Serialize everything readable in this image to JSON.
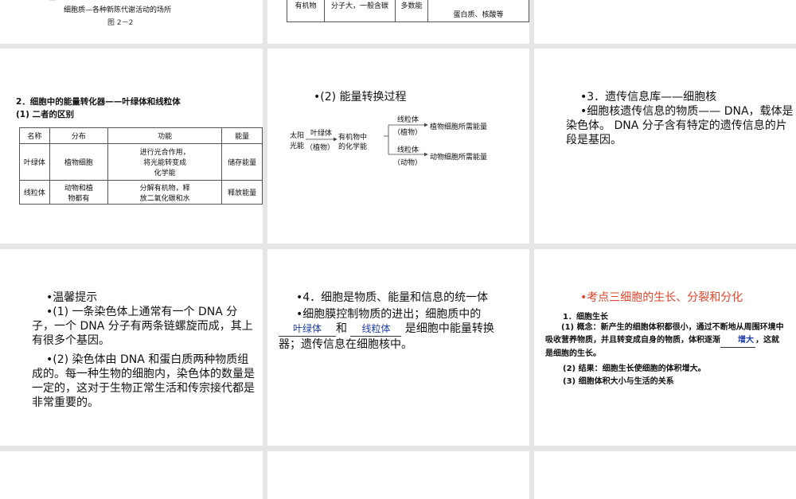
{
  "s_cell_top": {
    "caption": "细胞质—各种新陈代谢活动的场所",
    "figure": "图 2－2"
  },
  "s_org_top": {
    "row_name": "有机物",
    "col1": "分子大，一般含碳",
    "col2": "多数能",
    "col3": "蛋白质、核酸等"
  },
  "s_convert": {
    "heading": "2．细胞中的能量转化器——叶绿体和线粒体",
    "subheading": "(1)  二者的区别",
    "headers": [
      "名称",
      "分布",
      "功能",
      "能量"
    ],
    "rows": [
      {
        "name": "叶绿体",
        "dist": "植物细胞",
        "func": [
          "进行光合作用，",
          "将光能转变成",
          "化学能"
        ],
        "energy": "储存能量"
      },
      {
        "name": "线粒体",
        "dist": [
          "动物和植",
          "物都有"
        ],
        "func": [
          "分解有机物，释",
          "放二氧化碳和水"
        ],
        "energy": "释放能量"
      }
    ]
  },
  "s_process": {
    "title": "•(2) 能量转换过程",
    "src1": "太阳",
    "src2": "光能",
    "lbl1": "叶绿体",
    "lbl2": "（植物）",
    "mid1": "有机物中",
    "mid2": "的化学能",
    "top1": "线粒体",
    "top2": "（植物）",
    "top_target": "植物细胞所需能量",
    "bot1": "线粒体",
    "bot2": "（动物）",
    "bot_target": "动物细胞所需能量"
  },
  "s_nucleus": {
    "title": "•3．遗传信息库——细胞核",
    "body": "•细胞核遗传信息的物质—— DNA，载体是染色体。 DNA 分子含有特定的遗传信息的片段是基因。"
  },
  "s_tips": {
    "title": "•温馨提示",
    "p1": "•(1) 一条染色体上通常有一个 DNA 分子，一个 DNA 分子有两条链螺旋而成，其上有很多个基因。",
    "p2": "•(2) 染色体由 DNA 和蛋白质两种物质组成的。每一种生物的细胞内，染色体的数量是一定的，这对于生物正常生活和传宗接代都是非常重要的。"
  },
  "s_unity": {
    "title": "•4．细胞是物质、能量和信息的统一体",
    "p1": "•细胞膜控制物质的进出；细胞质中的",
    "blank1": "叶绿体",
    "and": "和",
    "blank2": "线粒体",
    "p2": "是细胞中能量转换",
    "p3": "器；遗传信息在细胞核中。"
  },
  "s_growth": {
    "title": "•考点三细胞的生长、分裂和分化",
    "h1": "1．细胞生长",
    "p1": "(1) 概念：新产生的细胞体积都很小，通过不断地从周围环境中吸收营养物质，并且转变成自身的物质，体积逐渐",
    "blank": "增大",
    "p1_end": "，这就是细胞的生长。",
    "p2": "(2) 结果：细胞生长使细胞的体积增大。",
    "p3": "(3) 细胞体积大小与生活的关系"
  },
  "colors": {
    "accent_red": "#e0442a",
    "fill_blue": "#1c3ca8",
    "background": "#e6e6e6"
  }
}
